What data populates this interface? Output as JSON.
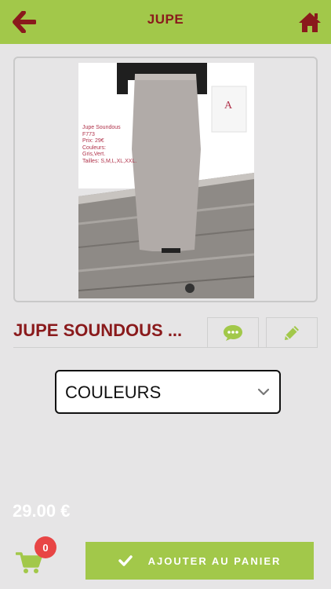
{
  "header": {
    "title": "JUPE",
    "back_icon": "arrow-left-icon",
    "home_icon": "home-icon",
    "accent_color": "#a2c84a",
    "title_color": "#8a1a1c"
  },
  "product": {
    "photo_caption": [
      "Jupe Soundous",
      "F773",
      "Prix: 29€",
      "Couleurs:",
      "Gris,Vert.",
      "Tailles: S,M,L,XL,XXL."
    ],
    "name": "JUPE SOUNDOUS ...",
    "price": "29.00 €"
  },
  "actions": {
    "comment_icon": "comment-icon",
    "edit_icon": "pencil-icon"
  },
  "options": {
    "select_label": "COULEURS",
    "chevron_icon": "chevron-down-icon"
  },
  "cart": {
    "icon": "cart-icon",
    "count": "0",
    "badge_color": "#e84545",
    "add_label": "AJOUTER AU PANIER",
    "add_icon": "check-icon"
  }
}
